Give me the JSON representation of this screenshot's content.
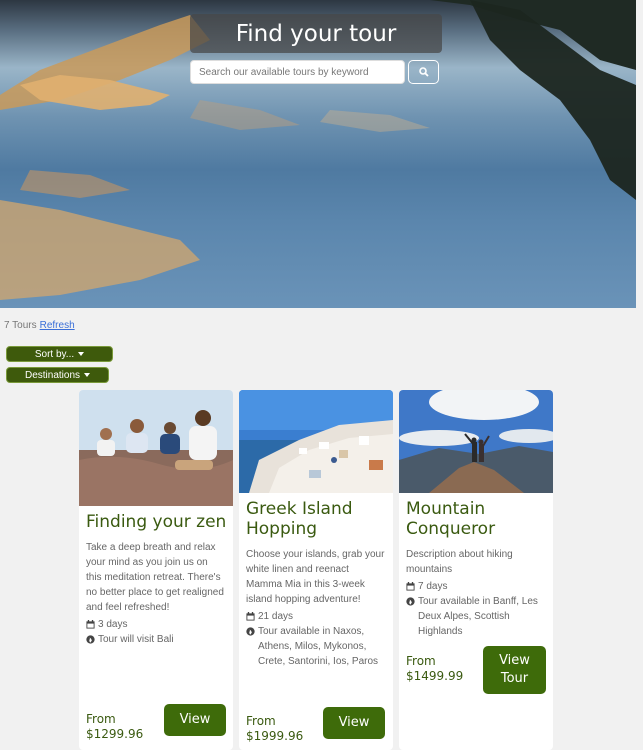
{
  "hero": {
    "title": "Find your tour",
    "search_placeholder": "Search our available tours by keyword",
    "search_icon": "search-icon"
  },
  "toolbar": {
    "count_label": "7 Tours",
    "refresh_label": "Refresh",
    "sort_label": "Sort by...",
    "destinations_label": "Destinations"
  },
  "cards": [
    {
      "title": "Finding your zen",
      "description": "Take a deep breath and relax your mind as you join us on this meditation retreat. There's no better place to get realigned and feel refreshed!",
      "duration": "3 days",
      "location": "Tour will visit Bali",
      "price_from": "From",
      "price": "$1299.96",
      "button": "View"
    },
    {
      "title": "Greek Island Hopping",
      "description": "Choose your islands, grab your white linen and reenact Mamma Mia in this 3-week island hopping adventure!",
      "duration": "21 days",
      "location": "Tour available in Naxos, Athens, Milos, Mykonos, Crete, Santorini, Ios, Paros",
      "price_from": "From",
      "price": "$1999.96",
      "button": "View"
    },
    {
      "title": "Mountain Conqueror",
      "description": "Description about hiking mountains",
      "duration": "7 days",
      "location": "Tour available in Banff, Les Deux Alpes, Scottish Highlands",
      "price_from": "From",
      "price": "$1499.99",
      "button": "View Tour"
    }
  ],
  "colors": {
    "brand_green": "#3e6b0a",
    "title_green": "#3a5a10",
    "link_blue": "#3a6fd8"
  }
}
